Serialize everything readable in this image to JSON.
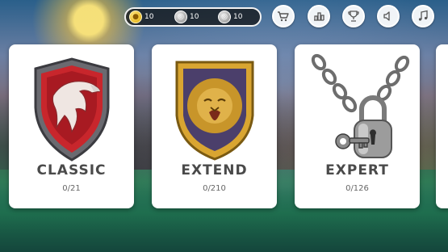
{
  "currencies": [
    {
      "icon": "gold-coin-icon",
      "value": "10"
    },
    {
      "icon": "silver-token-icon",
      "value": "10"
    },
    {
      "icon": "silver-token-icon",
      "value": "10"
    }
  ],
  "top_buttons": [
    "shop-cart-icon",
    "levels-icon",
    "trophy-icon",
    "sound-icon",
    "music-icon"
  ],
  "modes": [
    {
      "title": "CLASSIC",
      "progress": "0/21",
      "emblem": "eagle-shield-icon"
    },
    {
      "title": "EXTEND",
      "progress": "0/210",
      "emblem": "lion-shield-icon"
    },
    {
      "title": "EXPERT",
      "progress": "0/126",
      "emblem": "chained-padlock-icon"
    }
  ],
  "colors": {
    "card": "#ffffff",
    "title_text": "#4a4a4a",
    "pill_bg": "#1e1e1e",
    "gold": "#e0a800"
  }
}
